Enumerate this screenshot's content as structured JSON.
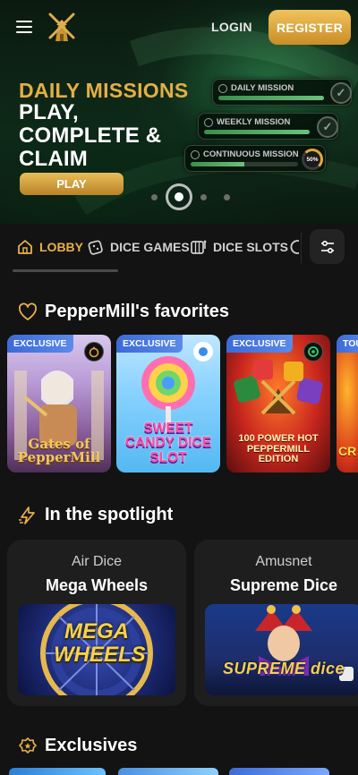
{
  "header": {
    "login_label": "LOGIN",
    "register_label": "REGISTER"
  },
  "hero": {
    "title_line1": "DAILY MISSIONS",
    "title_line2": "PLAY, COMPLETE & CLAIM",
    "play_label": "PLAY",
    "missions": [
      {
        "label": "DAILY MISSION",
        "progress": 1.0
      },
      {
        "label": "WEEKLY MISSION",
        "progress": 1.0
      },
      {
        "label": "CONTINUOUS MISSION",
        "progress": 0.5,
        "percent_text": "50%"
      }
    ],
    "carousel": {
      "count": 4,
      "active": 1
    }
  },
  "tabs": [
    {
      "label": "LOBBY",
      "icon": "home-icon",
      "active": true
    },
    {
      "label": "DICE GAMES",
      "icon": "dice-icon",
      "active": false
    },
    {
      "label": "DICE SLOTS",
      "icon": "slot-machine-icon",
      "active": false
    }
  ],
  "favorites": {
    "title": "PepperMill's favorites",
    "cards": [
      {
        "badge": "EXCLUSIVE",
        "caption": "Gates of PepperMill"
      },
      {
        "badge": "EXCLUSIVE",
        "caption": "SWEET CANDY DICE SLOT"
      },
      {
        "badge": "EXCLUSIVE",
        "caption": "100 POWER HOT PEPPERMILL EDITION"
      },
      {
        "badge": "TOU",
        "caption": "CR"
      }
    ]
  },
  "spotlight": {
    "title": "In the spotlight",
    "items": [
      {
        "provider": "Air Dice",
        "name": "Mega Wheels",
        "art_text": "MEGA WHEELS"
      },
      {
        "provider": "Amusnet",
        "name": "Supreme Dice",
        "art_text": "SUPREME dice"
      }
    ]
  },
  "exclusives": {
    "title": "Exclusives"
  },
  "colors": {
    "accent_gold": "#e4ae44",
    "background": "#131313",
    "badge_blue": "#3c6ad8"
  }
}
